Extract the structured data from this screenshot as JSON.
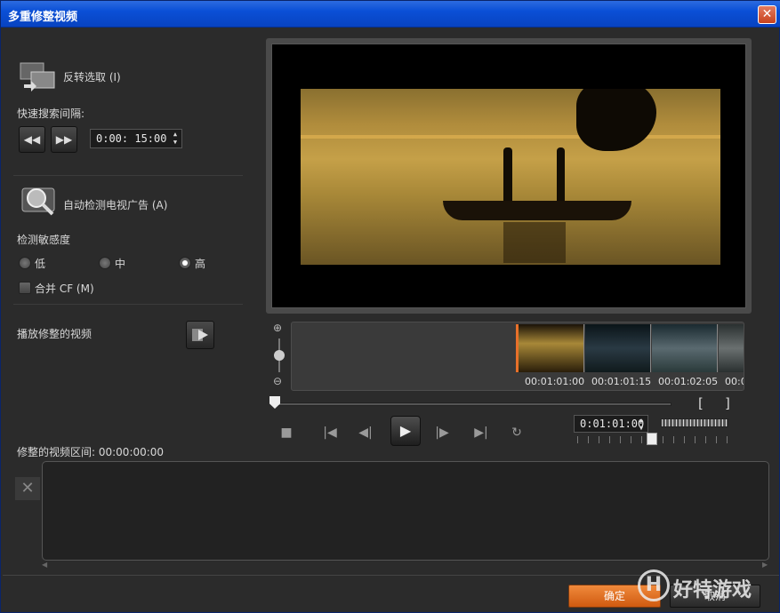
{
  "window": {
    "title": "多重修整视频",
    "close_label": "✕"
  },
  "left": {
    "invert_label": "反转选取 (I)",
    "quick_search_label": "快速搜索间隔:",
    "interval_value": "0:00: 15:00",
    "auto_detect_label": "自动检测电视广告 (A)",
    "sensitivity_label": "检测敏感度",
    "sensitivity_options": [
      "低",
      "中",
      "高"
    ],
    "sensitivity_selected": "高",
    "merge_label": "合并  CF (M)",
    "play_trimmed_label": "播放修整的视频",
    "trimmed_interval_label": "修整的视频区间: 00:00:00:00"
  },
  "timeline": {
    "thumb_times": [
      "00:01:01:00",
      "00:01:01:15",
      "00:01:02:05",
      "00:0"
    ],
    "mark_in": "[",
    "mark_out": "]",
    "timecode": "0:01:01:00"
  },
  "footer": {
    "ok_label": "确定",
    "cancel_label": "取消",
    "watermark": "好特游戏"
  },
  "colors": {
    "accent": "#e8702a",
    "titlebar": "#0a4fd6",
    "panel": "#2b2b2b"
  }
}
